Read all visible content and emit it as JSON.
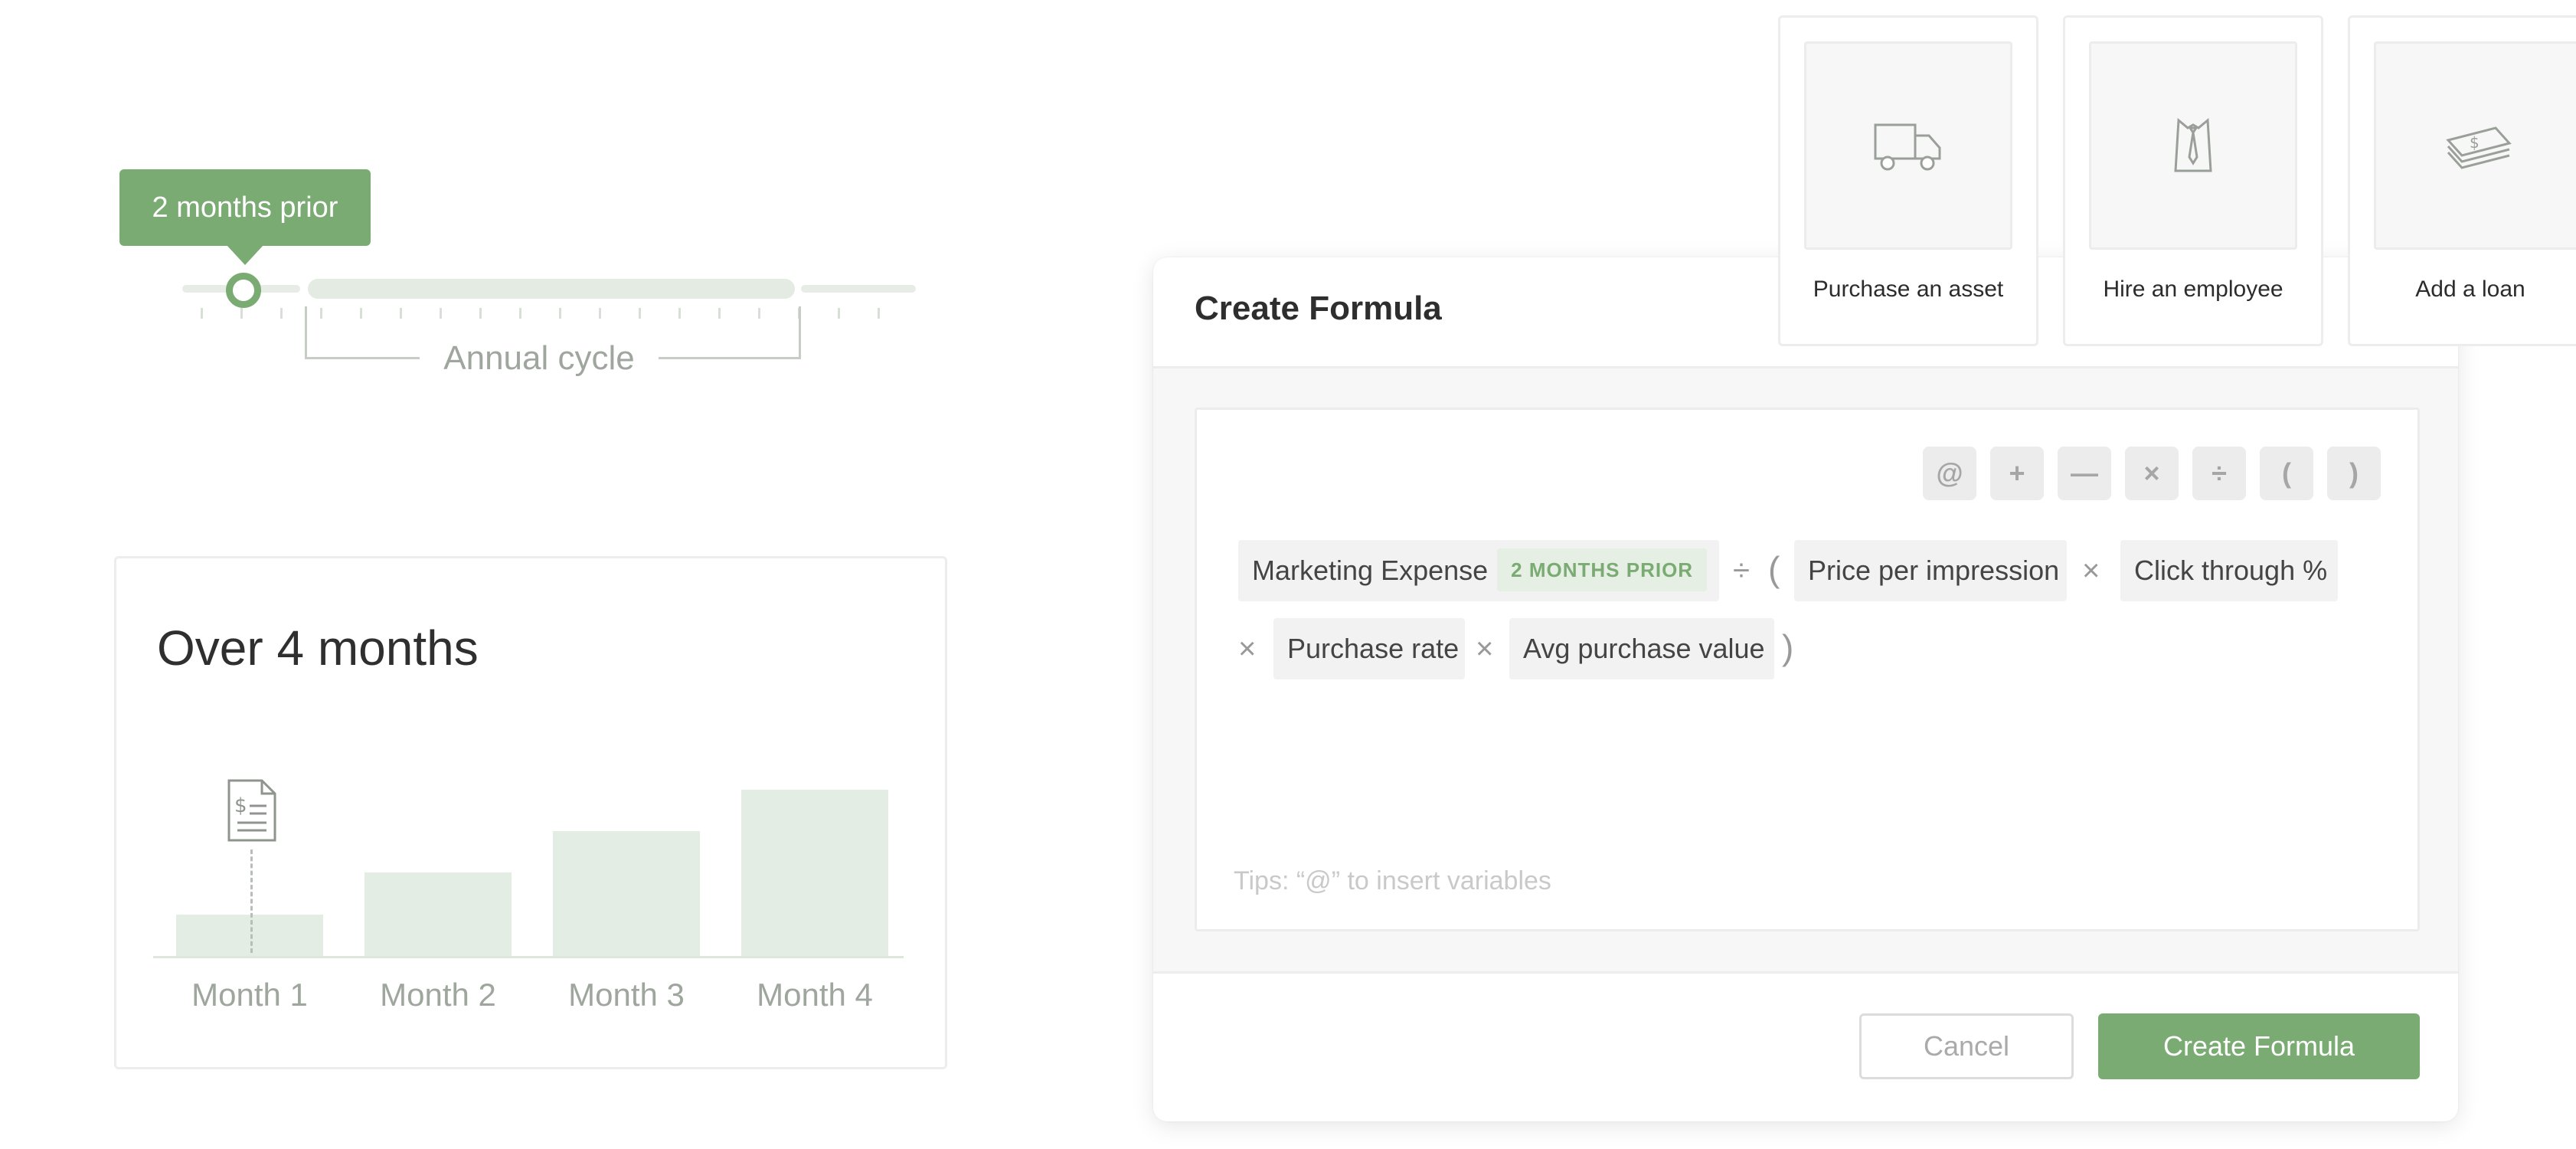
{
  "timeline": {
    "tooltip": "2 months prior",
    "bracket_label": "Annual cycle",
    "handle_position_index": 1
  },
  "months_card": {
    "title": "Over 4 months",
    "chart_data": {
      "type": "bar",
      "categories": [
        "Month 1",
        "Month 2",
        "Month 3",
        "Month 4"
      ],
      "values": [
        1,
        2,
        3,
        4
      ],
      "title": "Over 4 months",
      "ylim": [
        0,
        4.2
      ],
      "grid": false,
      "legend": "none"
    },
    "marker_icon": "invoice-doc-icon"
  },
  "modal": {
    "title": "Create Formula",
    "operators": [
      "@",
      "+",
      "—",
      "×",
      "÷",
      "(",
      ")"
    ],
    "formula": {
      "var1": "Marketing Expense",
      "var1_tag": "2 MONTHS PRIOR",
      "div": "÷",
      "open_paren": "(",
      "var2": "Price per impression",
      "mul1": "×",
      "var3": "Click through %",
      "mul2": "×",
      "var4": "Purchase rate",
      "mul3": "×",
      "var5": "Avg purchase value",
      "close_paren": ")"
    },
    "tips": "Tips: “@” to insert variables",
    "cancel_label": "Cancel",
    "create_label": "Create Formula"
  },
  "actions": [
    {
      "label": "Purchase an asset",
      "icon": "truck-icon"
    },
    {
      "label": "Hire an employee",
      "icon": "shirt-tie-icon"
    },
    {
      "label": "Add a loan",
      "icon": "money-stack-icon"
    }
  ],
  "colors": {
    "accent": "#7aab72",
    "accent_light": "#e4ede3",
    "muted_text": "#9ea69d"
  }
}
